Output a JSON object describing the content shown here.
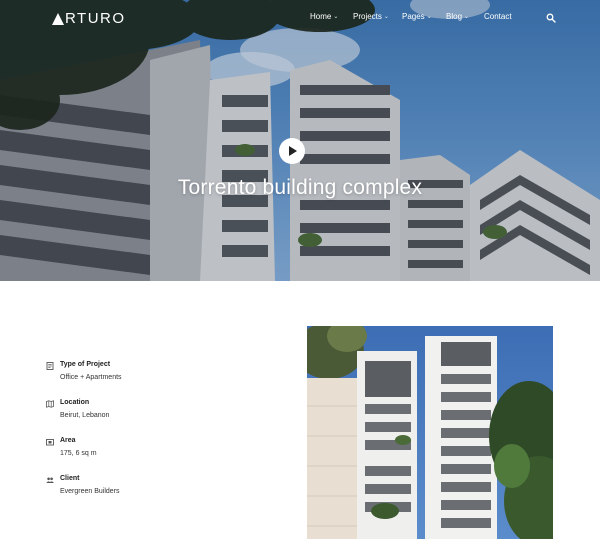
{
  "brand": {
    "logo_text": "RTURO"
  },
  "nav": {
    "items": [
      {
        "label": "Home",
        "has_dropdown": true
      },
      {
        "label": "Projects",
        "has_dropdown": true
      },
      {
        "label": "Pages",
        "has_dropdown": true
      },
      {
        "label": "Blog",
        "has_dropdown": true
      },
      {
        "label": "Contact",
        "has_dropdown": false
      }
    ],
    "chevron": "⌄",
    "search_icon": "search-icon"
  },
  "hero": {
    "title": "Torrento building complex",
    "play_icon": "play-icon"
  },
  "details": [
    {
      "icon": "document-icon",
      "label": "Type of Project",
      "value": "Office + Apartments"
    },
    {
      "icon": "map-icon",
      "label": "Location",
      "value": "Beirut, Lebanon"
    },
    {
      "icon": "area-icon",
      "label": "Area",
      "value": "175, 6 sq m"
    },
    {
      "icon": "user-group-icon",
      "label": "Client",
      "value": "Evergreen Builders"
    }
  ],
  "colors": {
    "sky": "#4a82c0",
    "text": "#222222",
    "background": "#ffffff"
  }
}
